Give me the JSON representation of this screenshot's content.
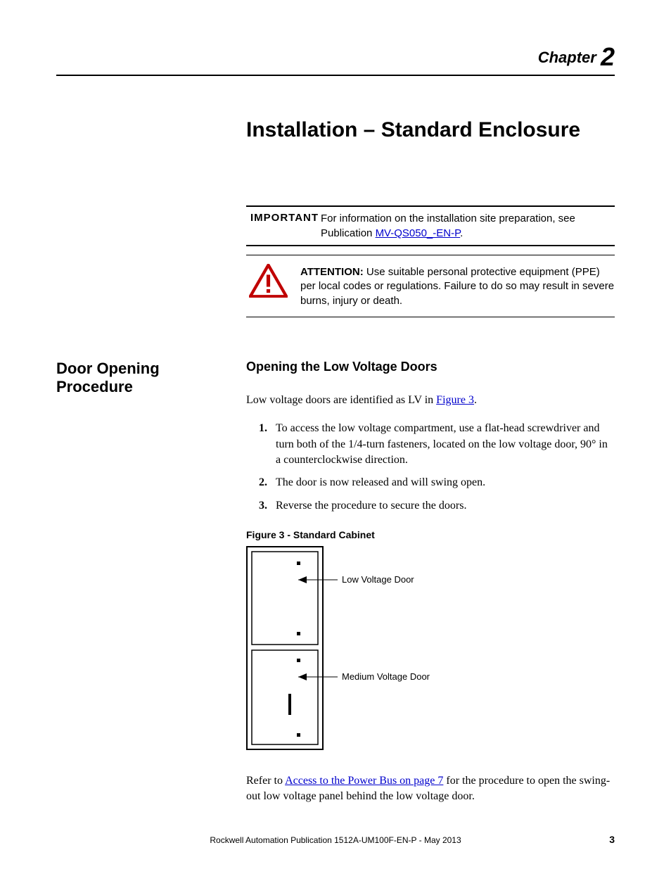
{
  "chapter": {
    "label": "Chapter",
    "number": "2"
  },
  "title": "Installation – Standard Enclosure",
  "important": {
    "label": "IMPORTANT",
    "text_before": "For information on the installation site preparation, see Publication ",
    "link": "MV-QS050_-EN-P",
    "text_after": "."
  },
  "attention": {
    "label": "ATTENTION:",
    "text": " Use suitable personal protective equipment (PPE) per local codes or regulations. Failure to do so may result in severe burns, injury or death."
  },
  "side_heading": "Door Opening Procedure",
  "sub_heading": "Opening the Low Voltage Doors",
  "intro": {
    "before": "Low voltage doors are identified as LV in ",
    "link": "Figure 3",
    "after": "."
  },
  "steps": [
    "To access the low voltage compartment, use a flat-head screwdriver and turn both of the 1/4-turn fasteners, located on the low voltage door, 90° in a counterclockwise direction.",
    "The door is now released and will swing open.",
    "Reverse the procedure to secure the doors."
  ],
  "figure": {
    "caption": "Figure 3 - Standard Cabinet",
    "label_top": "Low Voltage Door",
    "label_bottom": "Medium Voltage Door"
  },
  "refer": {
    "before": "Refer to ",
    "link": "Access to the Power Bus on page 7",
    "after": " for the procedure to open the swing-out low voltage panel behind the low voltage door."
  },
  "footer": {
    "text": "Rockwell Automation Publication 1512A-UM100F-EN-P - May 2013",
    "page": "3"
  }
}
